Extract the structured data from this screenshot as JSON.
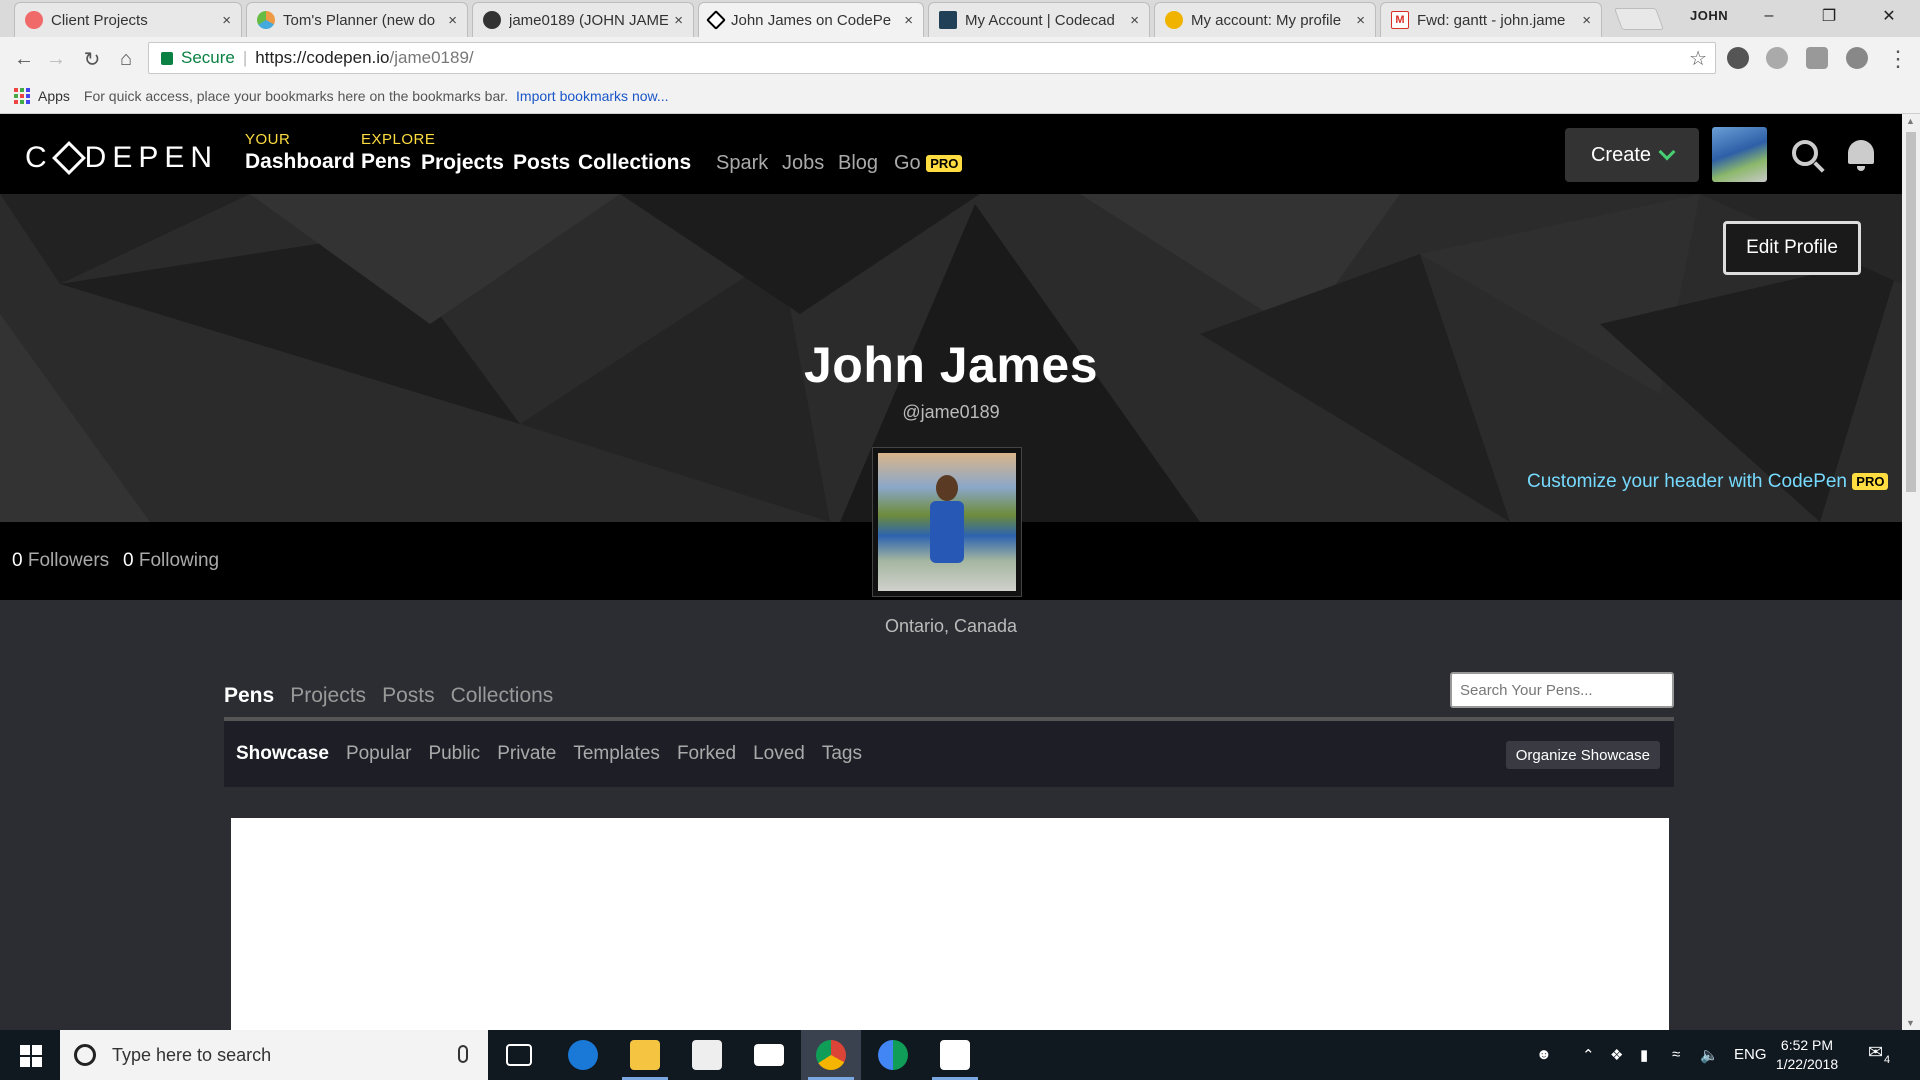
{
  "browser": {
    "tabs": [
      {
        "title": "Client Projects",
        "icon": "asana-icon",
        "color": "#f06a6a"
      },
      {
        "title": "Tom's Planner (new do",
        "icon": "toms-planner-icon",
        "color": "#4aa3df"
      },
      {
        "title": "jame0189 (JOHN JAME",
        "icon": "github-icon",
        "color": "#333333"
      },
      {
        "title": "John James on CodePe",
        "icon": "codepen-icon",
        "color": "#000000"
      },
      {
        "title": "My Account | Codecad",
        "icon": "codecademy-icon",
        "color": "#1f4056"
      },
      {
        "title": "My account: My profile",
        "icon": "profile-icon",
        "color": "#f0b400"
      },
      {
        "title": "Fwd: gantt - john.jame",
        "icon": "gmail-icon",
        "color": "#d93025"
      }
    ],
    "close_glyph": "×",
    "window_user": "JOHN",
    "url": {
      "secure_label": "Secure",
      "host": "https://codepen.io",
      "path": "/jame0189/"
    },
    "bookmarks": {
      "apps_label": "Apps",
      "hint": "For quick access, place your bookmarks here on the bookmarks bar.",
      "import_label": "Import bookmarks now..."
    }
  },
  "codepen": {
    "logo": {
      "left": "C",
      "right": "DEPEN"
    },
    "nav": {
      "your_label": "YOUR",
      "dashboard": "Dashboard",
      "explore_label": "EXPLORE",
      "pens": "Pens",
      "projects": "Projects",
      "posts": "Posts",
      "collections": "Collections",
      "spark": "Spark",
      "jobs": "Jobs",
      "blog": "Blog",
      "go": "Go",
      "pro_badge": "PRO"
    },
    "create_label": "Create",
    "accent": "#47cf73"
  },
  "profile": {
    "edit_label": "Edit Profile",
    "name": "John James",
    "handle": "@jame0189",
    "customize_label": "Customize your header with CodePen",
    "customize_badge": "PRO",
    "followers_count": "0",
    "followers_label": "Followers",
    "following_count": "0",
    "following_label": "Following",
    "location": "Ontario, Canada"
  },
  "content": {
    "tabs": [
      "Pens",
      "Projects",
      "Posts",
      "Collections"
    ],
    "search_placeholder": "Search Your Pens...",
    "subtabs": [
      "Showcase",
      "Popular",
      "Public",
      "Private",
      "Templates",
      "Forked",
      "Loved",
      "Tags"
    ],
    "organize_label": "Organize Showcase"
  },
  "taskbar": {
    "search_placeholder": "Type here to search",
    "language": "ENG",
    "time": "6:52 PM",
    "date": "1/22/2018",
    "notification_count": "4"
  }
}
